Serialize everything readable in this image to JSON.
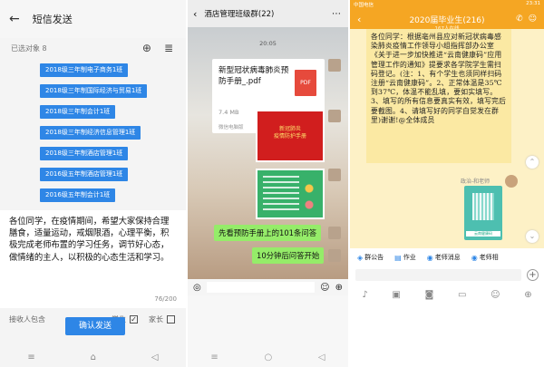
{
  "panel1": {
    "title": "短信发送",
    "selected": "已选对象 8",
    "tags": [
      "2018级三年制电子商务1班",
      "2018级三年制国际经济与贸易1班",
      "2018级三年制会计1班",
      "2018级三年制经济信息管理1班",
      "2018级三年制酒店管理1班",
      "2016级五年制酒店管理1班",
      "2016级五年制会计1班"
    ],
    "message": "各位同学，在疫情期间，希望大家保持合理膳食，适量运动，戒烟限酒，心理平衡，积极完成老师布置的学习任务，调节好心态，做情绪的主人，以积极的心态生活和学习。",
    "counter": "76/200",
    "receivers_label": "接收人包含",
    "opt_student": "学生",
    "opt_parent": "家长",
    "student_checked": "✓",
    "confirm": "确认发送"
  },
  "panel2": {
    "title": "酒店管理班级群(22)",
    "file_title": "新型冠状病毒肺炎预防手册_.pdf",
    "file_size": "7.4 MB",
    "file_from": "微信电脑版",
    "pdf_badge": "PDF",
    "time": "20:05",
    "red_text": "新冠肺炎\n疫情防护手册",
    "msg1": "先看预防手册上的101条问答",
    "msg2": "10分钟后问答开始"
  },
  "panel3": {
    "status_left": "中国电信",
    "status_right": "23:31",
    "title": "2020届毕业生(216)",
    "subtitle": "167人在线",
    "notice": "各位同学：根据亳州县应对新冠状病毒感染肺炎疫情工作领导小组指挥部办公室《关于进一步加快推进“云南健康码”应用管理工作的通知》提要求各学院学生需扫码登记。(注：1、有个学生也须同样扫码注册“云南健康码”。2、正常体温是35℃到37℃，体温不能乱填，要如实填写。3、填写的所有信息要真实有效，填写完后要截图。4、请填写好的同学自觉发在群里)谢谢!@全体成员",
    "sender": "政治-和老师",
    "qr_caption": "云南健康码",
    "toolbar": [
      "群公告",
      "作业",
      "老师消息",
      "老师相"
    ]
  },
  "colors": {
    "accent": "#2e86e6",
    "wechat_green": "#95ec69",
    "qq_orange": "#f5a623"
  }
}
